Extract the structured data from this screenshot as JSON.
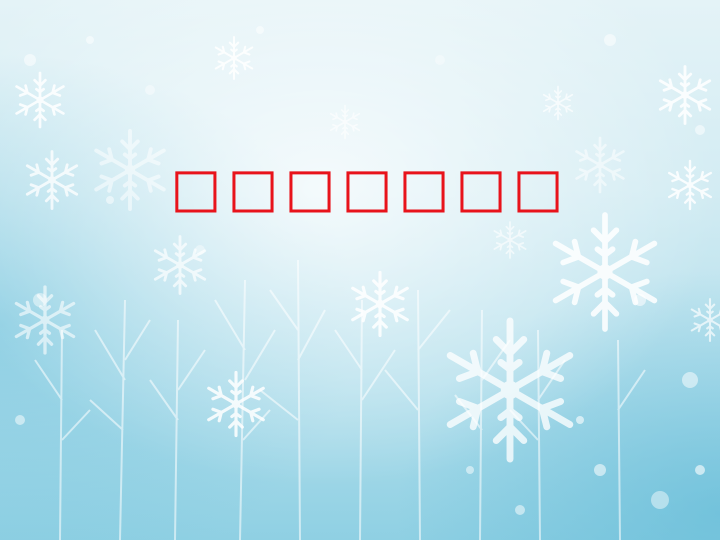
{
  "slide": {
    "title": "□□□□□□□"
  },
  "colors": {
    "title": "#e8131b",
    "sky_light": "#e6f4f8",
    "sky_mid": "#bfe3ee",
    "sky_deep": "#7fc6dc",
    "snow": "#ffffff"
  },
  "icons": [
    "snowflake-icon",
    "tree-icon"
  ]
}
